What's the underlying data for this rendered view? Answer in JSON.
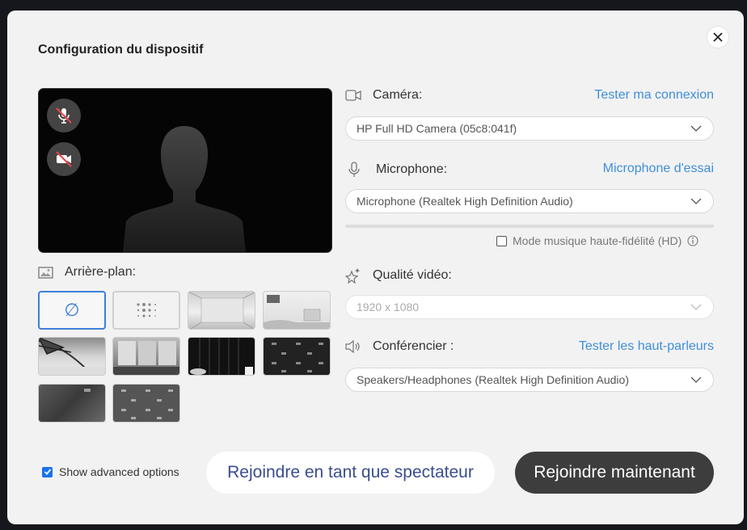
{
  "dialog": {
    "title": "Configuration du dispositif",
    "close_icon": "close-icon"
  },
  "background": {
    "label": "Arrière-plan:",
    "none_symbol": "∅"
  },
  "camera": {
    "label": "Caméra:",
    "link": "Tester ma connexion",
    "selected": "HP Full HD Camera (05c8:041f)"
  },
  "microphone": {
    "label": "Microphone:",
    "link": "Microphone d'essai",
    "selected": "Microphone (Realtek High Definition Audio)",
    "hifi_label": "Mode musique haute-fidélité (HD)"
  },
  "video_quality": {
    "label": "Qualité vidéo:",
    "selected": "1920 x 1080"
  },
  "speaker": {
    "label": "Conférencier :",
    "link": "Tester les haut-parleurs",
    "selected": "Speakers/Headphones (Realtek High Definition Audio)"
  },
  "footer": {
    "advanced_label": "Show advanced options",
    "spectator_button": "Rejoindre en tant que spectateur",
    "join_button": "Rejoindre maintenant"
  }
}
